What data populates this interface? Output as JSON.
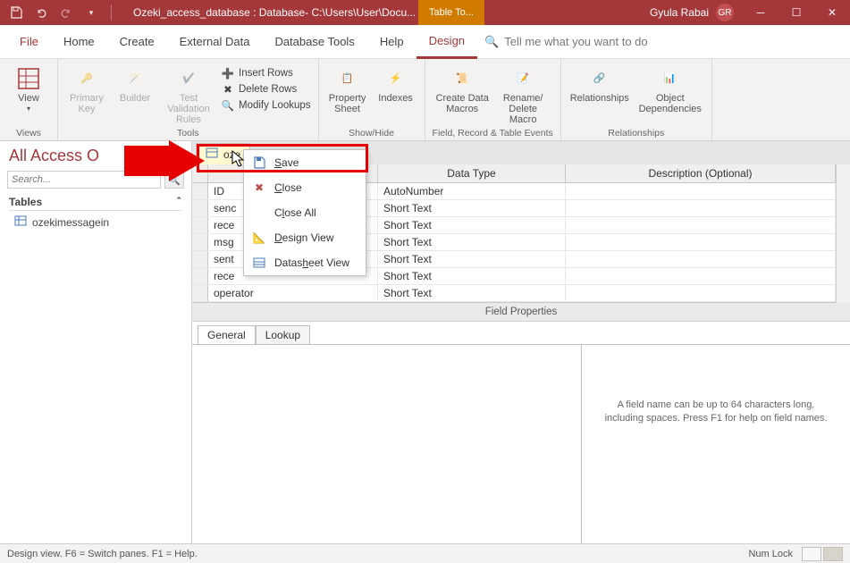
{
  "titlebar": {
    "title": "Ozeki_access_database : Database- C:\\Users\\User\\Docu...",
    "contextual_tab": "Table To...",
    "user_name": "Gyula Rabai",
    "user_initials": "GR"
  },
  "menu": {
    "file": "File",
    "home": "Home",
    "create": "Create",
    "external_data": "External Data",
    "database_tools": "Database Tools",
    "help": "Help",
    "design": "Design",
    "tellme": "Tell me what you want to do"
  },
  "ribbon": {
    "views": {
      "view": "View",
      "group": "Views"
    },
    "tools": {
      "primary_key": "Primary Key",
      "builder": "Builder",
      "test_validation": "Test Validation Rules",
      "insert_rows": "Insert Rows",
      "delete_rows": "Delete Rows",
      "modify_lookups": "Modify Lookups",
      "group": "Tools"
    },
    "showhide": {
      "property_sheet": "Property Sheet",
      "indexes": "Indexes",
      "group": "Show/Hide"
    },
    "events": {
      "create_data_macros": "Create Data Macros",
      "rename_delete": "Rename/ Delete Macro",
      "group": "Field, Record & Table Events"
    },
    "relationships": {
      "relationships": "Relationships",
      "object_deps": "Object Dependencies",
      "group": "Relationships"
    }
  },
  "nav": {
    "title": "All Access O",
    "search_placeholder": "Search...",
    "tables_label": "Tables",
    "items": [
      "ozekimessagein"
    ]
  },
  "doctab": {
    "label": "oze"
  },
  "grid": {
    "head_name": "",
    "head_type": "Data Type",
    "head_desc": "Description (Optional)",
    "rows": [
      {
        "name": "ID",
        "type": "AutoNumber"
      },
      {
        "name": "senc",
        "type": "Short Text"
      },
      {
        "name": "rece",
        "type": "Short Text"
      },
      {
        "name": "msg",
        "type": "Short Text"
      },
      {
        "name": "sent",
        "type": "Short Text"
      },
      {
        "name": "rece",
        "type": "Short Text"
      },
      {
        "name": "operator",
        "type": "Short Text"
      }
    ]
  },
  "field_props": {
    "label": "Field Properties",
    "tab_general": "General",
    "tab_lookup": "Lookup",
    "info": "A field name can be up to 64 characters long, including spaces. Press F1 for help on field names."
  },
  "context_menu": {
    "save": "Save",
    "close": "Close",
    "close_all": "Close All",
    "design_view": "Design View",
    "datasheet_view": "Datasheet View"
  },
  "status": {
    "left": "Design view.   F6 = Switch panes.   F1 = Help.",
    "numlock": "Num Lock"
  }
}
